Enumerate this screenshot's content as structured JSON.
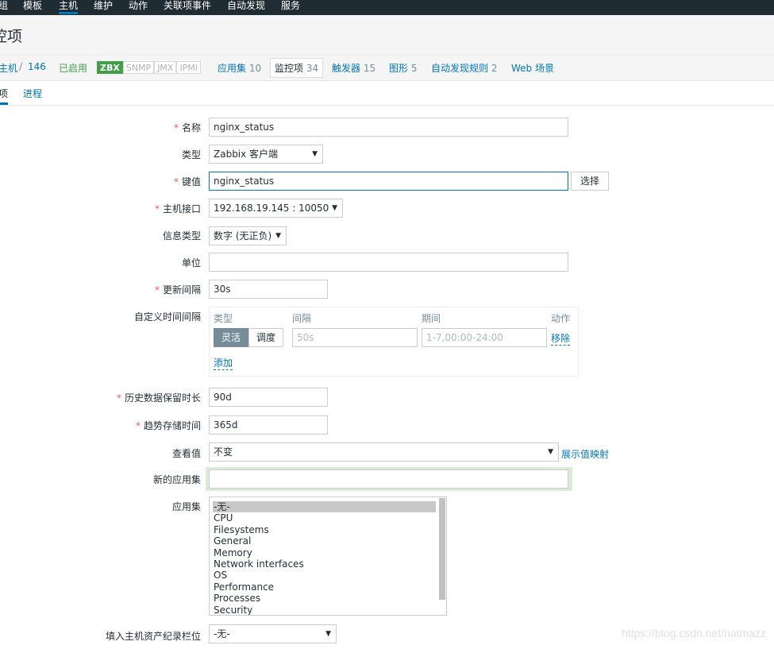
{
  "topnav": {
    "items": [
      "组",
      "模板",
      "主机",
      "维护",
      "动作",
      "关联项事件",
      "自动发现",
      "服务"
    ]
  },
  "page": {
    "title": "控项"
  },
  "host_tabs": {
    "all_hosts": "主机",
    "separator": "/",
    "host_name": "146",
    "status": "已启用",
    "availability": [
      "ZBX",
      "SNMP",
      "JMX",
      "IPMI"
    ],
    "applications": {
      "label": "应用集",
      "count": "10"
    },
    "items": {
      "label": "监控项",
      "count": "34"
    },
    "triggers": {
      "label": "触发器",
      "count": "15"
    },
    "graphs": {
      "label": "图形",
      "count": "5"
    },
    "discovery": {
      "label": "自动发现规则",
      "count": "2"
    },
    "web": {
      "label": "Web 场景"
    }
  },
  "subtabs": {
    "item": "项",
    "preprocessing": "进程"
  },
  "form": {
    "name": {
      "label": "名称",
      "value": "nginx_status"
    },
    "type": {
      "label": "类型",
      "value": "Zabbix 客户端"
    },
    "key": {
      "label": "键值",
      "value": "nginx_status",
      "button": "选择"
    },
    "interface": {
      "label": "主机接口",
      "value": "192.168.19.145 : 10050"
    },
    "info_type": {
      "label": "信息类型",
      "value": "数字 (无正负)"
    },
    "units": {
      "label": "单位",
      "value": ""
    },
    "update_interval": {
      "label": "更新间隔",
      "value": "30s"
    },
    "custom_intervals": {
      "label": "自定义时间间隔",
      "headers": {
        "type": "类型",
        "interval": "间隔",
        "period": "期间",
        "action": "动作"
      },
      "segment": {
        "flexible": "灵活",
        "scheduling": "调度"
      },
      "interval_placeholder": "50s",
      "period_placeholder": "1-7,00:00-24:00",
      "remove": "移除",
      "add": "添加"
    },
    "history": {
      "label": "历史数据保留时长",
      "value": "90d"
    },
    "trends": {
      "label": "趋势存储时间",
      "value": "365d"
    },
    "valuemap": {
      "label": "查看值",
      "value": "不变",
      "link": "展示值映射"
    },
    "new_application": {
      "label": "新的应用集",
      "value": ""
    },
    "applications": {
      "label": "应用集",
      "options": [
        "-无-",
        "CPU",
        "Filesystems",
        "General",
        "Memory",
        "Network interfaces",
        "OS",
        "Performance",
        "Processes",
        "Security"
      ]
    },
    "inventory": {
      "label": "填入主机资产纪录栏位",
      "value": "-无-"
    }
  },
  "watermark": "https://blog.csdn.net/natmazz"
}
